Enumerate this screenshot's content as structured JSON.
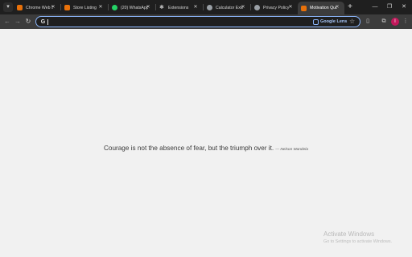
{
  "tabs": [
    {
      "title": "Chrome Web Store",
      "icon": "chrome-web-store-icon",
      "color": "#e8710a"
    },
    {
      "title": "Store Listing",
      "icon": "chrome-web-store-icon",
      "color": "#e8710a"
    },
    {
      "title": "(20) WhatsApp",
      "icon": "whatsapp-icon",
      "color": "#25d366"
    },
    {
      "title": "Extensions",
      "icon": "puzzle-icon",
      "color": "#9aa0a6"
    },
    {
      "title": "Calculator Exten",
      "icon": "globe-icon",
      "color": "#9aa0a6"
    },
    {
      "title": "Privacy Policy |",
      "icon": "globe-icon",
      "color": "#9aa0a6"
    },
    {
      "title": "Motivation Quo",
      "icon": "extension-icon",
      "color": "#e8710a",
      "active": true
    }
  ],
  "omnibox": {
    "value": "",
    "lens_label": "Google Lens"
  },
  "profile": {
    "initial": "I",
    "color": "#c2185b"
  },
  "quote": {
    "text": "Courage is not the absence of fear, but the triumph over it.",
    "author": "— Nelson Mandela"
  },
  "watermark": {
    "title": "Activate Windows",
    "subtitle": "Go to Settings to activate Windows."
  },
  "colors": {
    "accent": "#8ab4f8",
    "page_bg": "#f1f1f1",
    "chrome_dark": "#1f1f1f"
  }
}
